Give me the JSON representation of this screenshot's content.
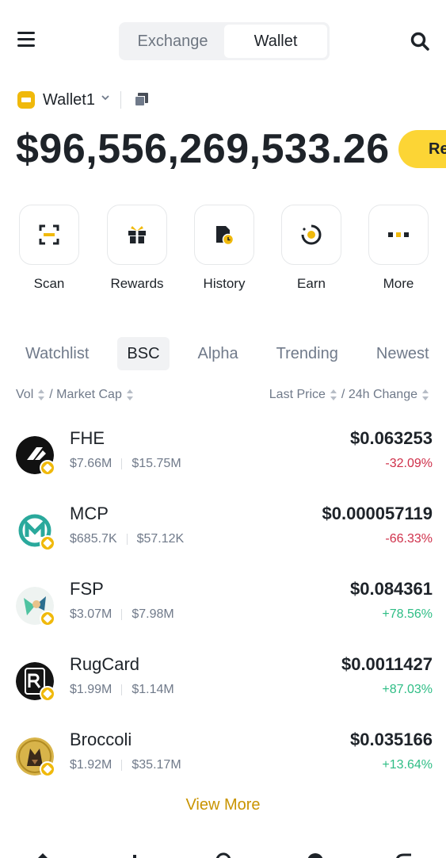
{
  "header": {
    "tabs": [
      {
        "label": "Exchange",
        "active": false
      },
      {
        "label": "Wallet",
        "active": true
      }
    ],
    "menu_icon": "hamburger-menu-icon",
    "search_icon": "search-icon"
  },
  "wallet": {
    "name": "Wallet1",
    "balance": "$96,556,269,533.26",
    "receive_label": "Re"
  },
  "actions": [
    {
      "label": "Scan",
      "icon": "scan-icon"
    },
    {
      "label": "Rewards",
      "icon": "gift-icon"
    },
    {
      "label": "History",
      "icon": "history-icon"
    },
    {
      "label": "Earn",
      "icon": "earn-icon"
    },
    {
      "label": "More",
      "icon": "more-dots-icon"
    }
  ],
  "market_tabs": [
    {
      "label": "Watchlist",
      "active": false
    },
    {
      "label": "BSC",
      "active": true
    },
    {
      "label": "Alpha",
      "active": false
    },
    {
      "label": "Trending",
      "active": false
    },
    {
      "label": "Newest",
      "active": false
    }
  ],
  "sort": {
    "vol": "Vol",
    "market_cap": "/ Market Cap",
    "last_price": "Last Price",
    "change": "/ 24h Change"
  },
  "tokens": [
    {
      "name": "FHE",
      "vol": "$7.66M",
      "mcap": "$15.75M",
      "price": "$0.063253",
      "change": "-32.09%",
      "direction": "down"
    },
    {
      "name": "MCP",
      "vol": "$685.7K",
      "mcap": "$57.12K",
      "price": "$0.000057119",
      "change": "-66.33%",
      "direction": "down"
    },
    {
      "name": "FSP",
      "vol": "$3.07M",
      "mcap": "$7.98M",
      "price": "$0.084361",
      "change": "+78.56%",
      "direction": "up"
    },
    {
      "name": "RugCard",
      "vol": "$1.99M",
      "mcap": "$1.14M",
      "price": "$0.0011427",
      "change": "+87.03%",
      "direction": "up"
    },
    {
      "name": "Broccoli",
      "vol": "$1.92M",
      "mcap": "$35.17M",
      "price": "$0.035166",
      "change": "+13.64%",
      "direction": "up"
    }
  ],
  "view_more": "View More",
  "colors": {
    "accent_yellow": "#fcd535",
    "link_gold": "#c99400",
    "up_green": "#2ebd85",
    "down_red": "#cf304a"
  }
}
